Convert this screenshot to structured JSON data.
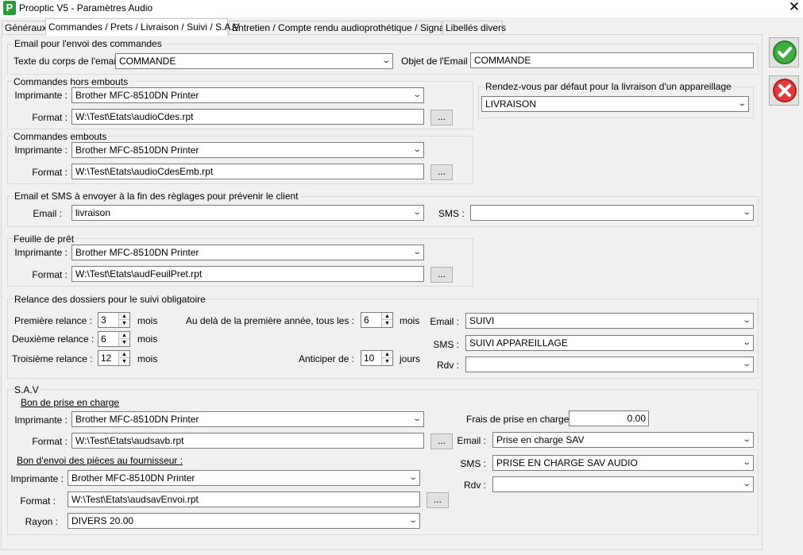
{
  "window": {
    "title": "Prooptic V5 - Paramètres Audio",
    "app_icon_letter": "P"
  },
  "tabs": [
    {
      "label": "Généraux"
    },
    {
      "label": "Commandes / Prets / Livraison / Suivi / S.A.V"
    },
    {
      "label": "Entretien / Compte rendu audioprothétique / Signature"
    },
    {
      "label": "Libellés divers"
    }
  ],
  "email_commandes": {
    "legend": "Email pour l'envoi des commandes",
    "body_label": "Texte du corps de l'email :",
    "body_value": "COMMANDE",
    "subject_label": "Objet de l'Email :",
    "subject_value": "COMMANDE"
  },
  "hors_embouts": {
    "legend": "Commandes hors embouts",
    "printer_label": "Imprimante :",
    "printer_value": "Brother MFC-8510DN Printer",
    "format_label": "Format :",
    "format_value": "W:\\Test\\Etats\\audioCdes.rpt",
    "browse": "..."
  },
  "rdv_livraison": {
    "legend": "Rendez-vous par défaut pour la livraison d'un appareillage",
    "value": "LIVRAISON"
  },
  "embouts": {
    "legend": "Commandes embouts",
    "printer_label": "Imprimante :",
    "printer_value": "Brother MFC-8510DN Printer",
    "format_label": "Format :",
    "format_value": "W:\\Test\\Etats\\audioCdesEmb.rpt",
    "browse": "..."
  },
  "reglages": {
    "legend": "Email et SMS à envoyer à la fin des règlages pour prévenir le client",
    "email_label": "Email :",
    "email_value": "livraison",
    "sms_label": "SMS :",
    "sms_value": ""
  },
  "pret": {
    "legend": "Feuille de prêt",
    "printer_label": "Imprimante :",
    "printer_value": "Brother MFC-8510DN Printer",
    "format_label": "Format :",
    "format_value": "W:\\Test\\Etats\\audFeuilPret.rpt",
    "browse": "..."
  },
  "relance": {
    "legend": "Relance des dossiers pour le suivi obligatoire",
    "r1_label": "Première relance :",
    "r1_value": "3",
    "r1_unit": "mois",
    "r2_label": "Deuxième relance :",
    "r2_value": "6",
    "r2_unit": "mois",
    "r3_label": "Troisième relance :",
    "r3_value": "12",
    "r3_unit": "mois",
    "after_label": "Au delà de la première année, tous les :",
    "after_value": "6",
    "after_unit": "mois",
    "anticiper_label": "Anticiper de :",
    "anticiper_value": "10",
    "anticiper_unit": "jours",
    "email_label": "Email :",
    "email_value": "SUIVI",
    "sms_label": "SMS :",
    "sms_value": "SUIVI APPAREILLAGE",
    "rdv_label": "Rdv :",
    "rdv_value": ""
  },
  "sav": {
    "legend": "S.A.V",
    "bon_prise_label": "Bon de prise en charge",
    "printer_label": "Imprimante :",
    "printer_value": "Brother MFC-8510DN Printer",
    "format_label": "Format :",
    "format_value": "W:\\Test\\Etats\\audsavb.rpt",
    "browse": "...",
    "frais_label": "Frais de prise en charge :",
    "frais_value": "0.00",
    "email_label": "Email :",
    "email_value": "Prise en charge SAV",
    "sms_label": "SMS :",
    "sms_value": "PRISE EN CHARGE SAV AUDIO",
    "rdv_label": "Rdv :",
    "rdv_value": "",
    "bon_envoi_label": "Bon d'envoi des pièces au fournisseur :",
    "printer2_label": "Imprimante :",
    "printer2_value": "Brother MFC-8510DN Printer",
    "format2_label": "Format :",
    "format2_value": "W:\\Test\\Etats\\audsavEnvoi.rpt",
    "browse2": "...",
    "rayon_label": "Rayon :",
    "rayon_value": "DIVERS 20.00"
  },
  "icons": {
    "ok": "checkmark-icon",
    "cancel": "cancel-x-icon",
    "dropdown": "chevron-down-icon",
    "close": "close-icon"
  },
  "colors": {
    "ok_green": "#3fae3f",
    "cancel_red": "#e33b3b"
  }
}
